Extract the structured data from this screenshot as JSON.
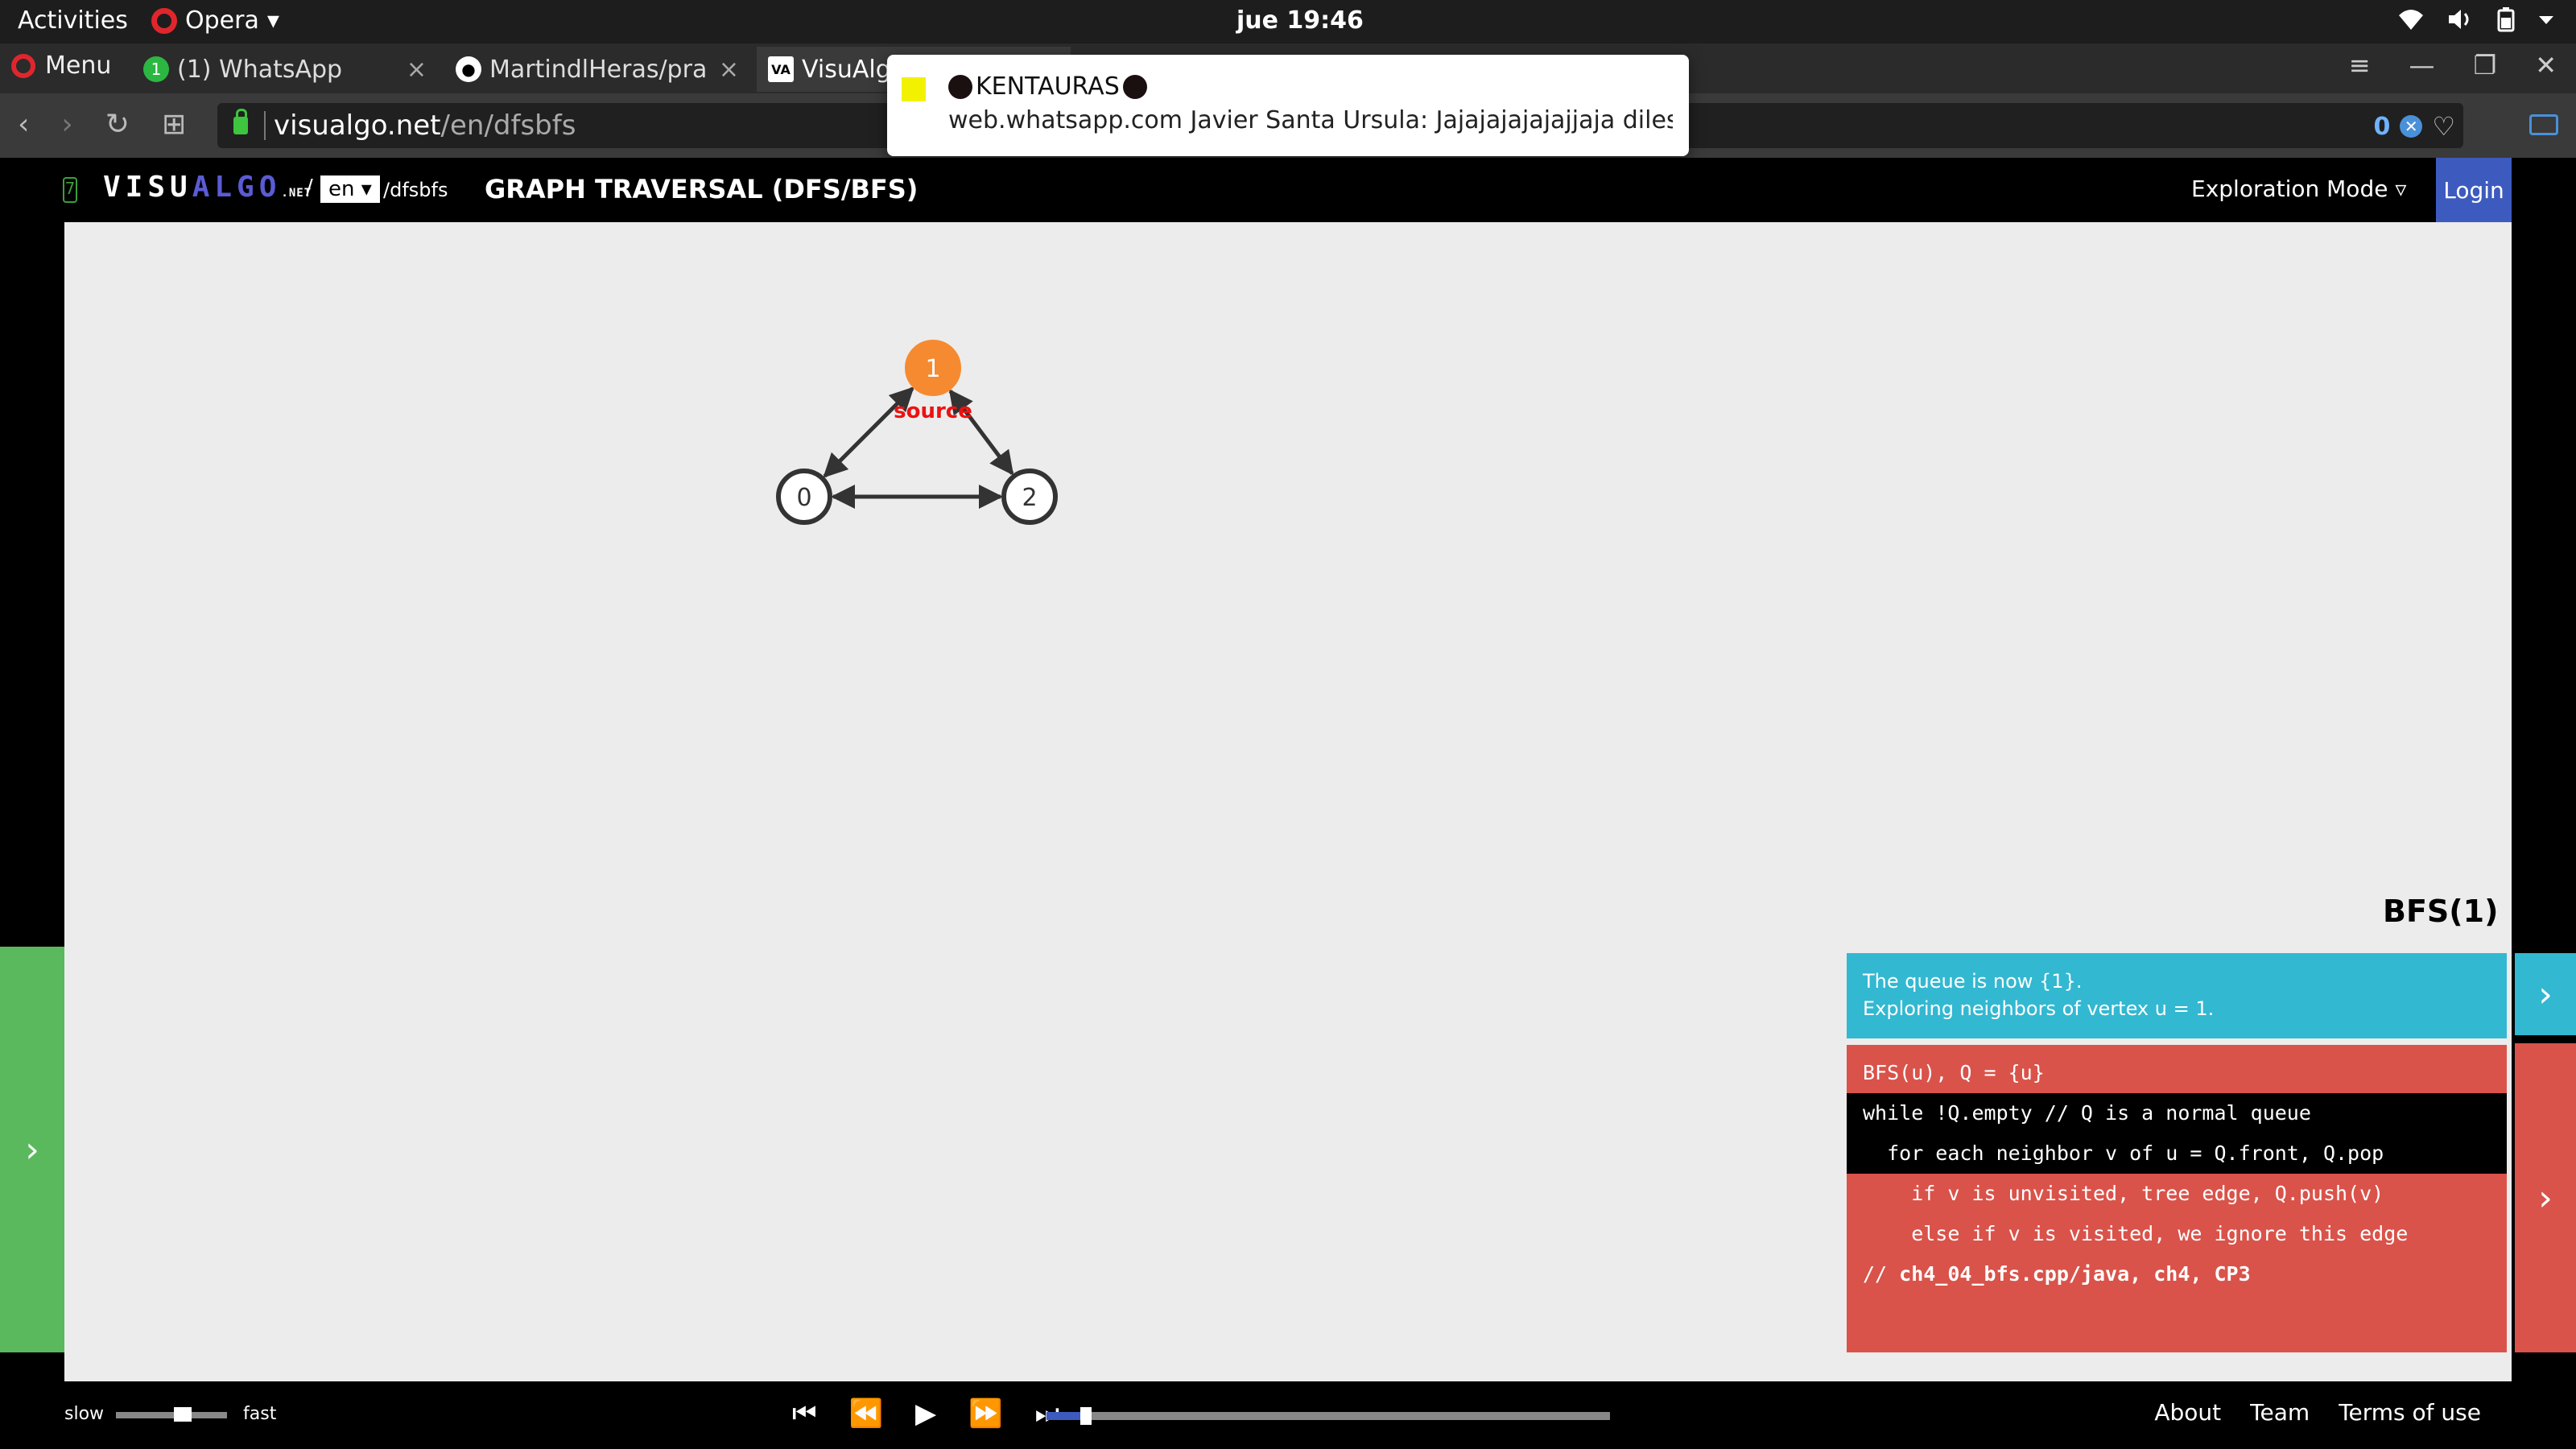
{
  "topbar": {
    "activities": "Activities",
    "app_name": "Opera",
    "app_menu_arrow": "▾",
    "clock": "jue 19:46",
    "tray_icons": [
      "wifi-icon",
      "volume-icon",
      "battery-icon",
      "power-menu-icon"
    ]
  },
  "browser": {
    "menu_label": "Menu",
    "tabs": [
      {
        "title": "(1) WhatsApp",
        "icon": "whatsapp-icon",
        "badge": "1",
        "close": "×"
      },
      {
        "title": "MartindlHeras/pract",
        "icon": "github-icon",
        "close": "×"
      },
      {
        "title": "VisuAlgo",
        "icon": "visualgo-icon",
        "icon_text": "VA"
      }
    ],
    "url_domain": "visualgo.net",
    "url_path": "/en/dfsbfs",
    "adblock_count": "0",
    "window_controls": [
      "tab-menu-icon",
      "minimize-icon",
      "restore-icon",
      "close-icon"
    ]
  },
  "notification": {
    "title": "KENTAURAS",
    "source": "web.whatsapp.com",
    "message": "Javier Santa Ursula: Jajajajajajajjaja diles qu…"
  },
  "visualgo": {
    "logo_text": "VISU",
    "logo_accent": "ALGO",
    "logo_suffix": ".NET",
    "slash": "/",
    "lang": "en ▾",
    "path": "/dfsbfs",
    "page_title": "GRAPH TRAVERSAL (DFS/BFS)",
    "mode": "Exploration Mode ▿",
    "login": "Login",
    "colors": {
      "accent": "#3d5bbf",
      "source_node": "#f68a30",
      "status": "#33b8d1",
      "code": "#d9534a",
      "left_panel": "#59b95c"
    }
  },
  "graph": {
    "nodes": [
      {
        "id": "0",
        "label": "0",
        "highlighted": false
      },
      {
        "id": "1",
        "label": "1",
        "highlighted": true,
        "tag": "source"
      },
      {
        "id": "2",
        "label": "2",
        "highlighted": false
      }
    ],
    "edges": [
      {
        "from": "0",
        "to": "1",
        "bidirectional": true
      },
      {
        "from": "1",
        "to": "2",
        "bidirectional": true
      },
      {
        "from": "0",
        "to": "2",
        "bidirectional": true
      }
    ]
  },
  "status": {
    "title": "BFS(1)",
    "line1": "The queue is now {1}.",
    "line2": "Exploring neighbors of vertex u = 1."
  },
  "code": {
    "lines": [
      {
        "text": "BFS(u), Q = {u}",
        "highlight": false
      },
      {
        "text": "while !Q.empty // Q is a normal queue",
        "highlight": true
      },
      {
        "text": "  for each neighbor v of u = Q.front, Q.pop",
        "highlight": true
      },
      {
        "text": "    if v is unvisited, tree edge, Q.push(v)",
        "highlight": false
      },
      {
        "text": "    else if v is visited, we ignore this edge",
        "highlight": false
      },
      {
        "text_prefix": "// ",
        "text_bold": "ch4_04_bfs.cpp/java, ch4, CP3",
        "highlight": false
      }
    ]
  },
  "controls": {
    "slow": "slow",
    "fast": "fast",
    "speed": 0.6,
    "progress": 0.07,
    "footer_links": [
      "About",
      "Team",
      "Terms of use"
    ]
  }
}
